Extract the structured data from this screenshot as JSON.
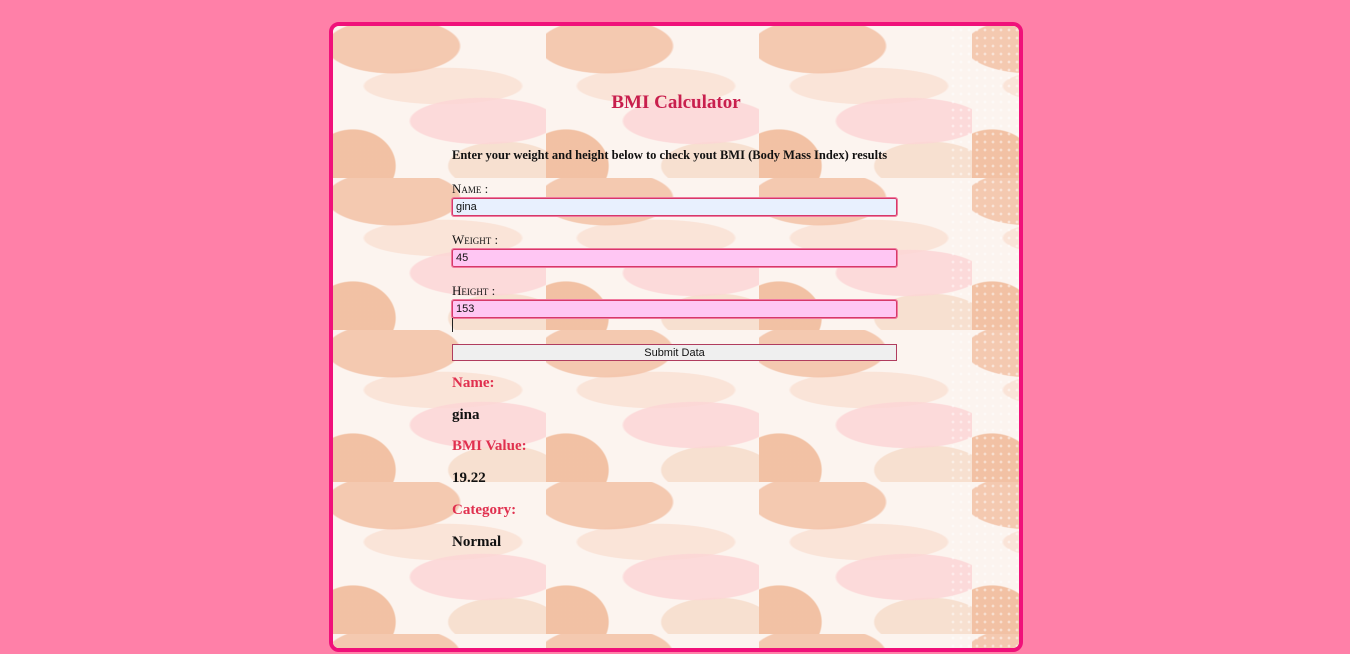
{
  "app": {
    "title": "BMI Calculator",
    "intro": "Enter your weight and height below to check yout BMI (Body Mass Index) results"
  },
  "form": {
    "name_label": "Name :",
    "name_value": "gina",
    "weight_label": "Weight :",
    "weight_value": "45",
    "height_label": "Height :",
    "height_value": "153",
    "submit_label": "Submit Data"
  },
  "results": {
    "name_label": "Name:",
    "name_value": "gina",
    "bmi_label": "BMI Value:",
    "bmi_value": "19.22",
    "category_label": "Category:",
    "category_value": "Normal"
  },
  "colors": {
    "page_background": "#ff80a8",
    "card_border": "#f0117a",
    "title": "#c81f4d",
    "result_label": "#e0304f",
    "input_pink": "#ffc6f3",
    "input_autofill": "#e8f0fe"
  }
}
